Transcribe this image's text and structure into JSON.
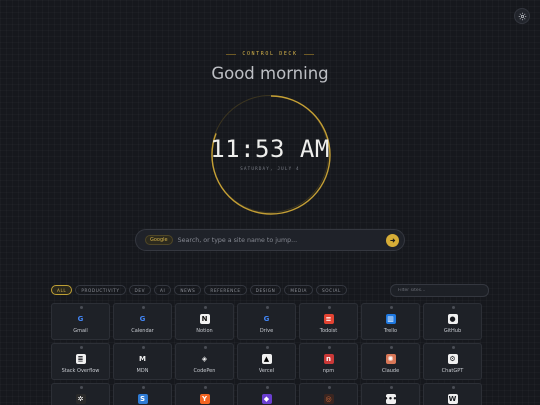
{
  "header": {
    "eyebrow": "CONTROL DECK",
    "greeting": "Good morning"
  },
  "clock": {
    "time": "11:53 AM",
    "date": "SATURDAY, JULY 4"
  },
  "search": {
    "engine": "Google",
    "placeholder": "Search, or type a site name to jump..."
  },
  "filters": {
    "chips": [
      "ALL",
      "PRODUCTIVITY",
      "DEV",
      "AI",
      "NEWS",
      "REFERENCE",
      "DESIGN",
      "MEDIA",
      "SOCIAL"
    ],
    "active": "ALL",
    "placeholder": "Filter sites..."
  },
  "colors": {
    "accent": "#d6ad37",
    "background": "#16181d",
    "tile": "#1e2127"
  },
  "sites": [
    {
      "label": "Gmail",
      "icon": "google-icon",
      "glyph": "G",
      "fg": "#4285f4",
      "bg": "transparent"
    },
    {
      "label": "Calendar",
      "icon": "google-icon",
      "glyph": "G",
      "fg": "#4285f4",
      "bg": "transparent"
    },
    {
      "label": "Notion",
      "icon": "notion-icon",
      "glyph": "N",
      "fg": "#111111",
      "bg": "#f2f2f2"
    },
    {
      "label": "Drive",
      "icon": "google-icon",
      "glyph": "G",
      "fg": "#4285f4",
      "bg": "transparent"
    },
    {
      "label": "Todoist",
      "icon": "todoist-icon",
      "glyph": "≡",
      "fg": "#ffffff",
      "bg": "#e44332"
    },
    {
      "label": "Trello",
      "icon": "trello-icon",
      "glyph": "▥",
      "fg": "#ffffff",
      "bg": "#1e78e0"
    },
    {
      "label": "GitHub",
      "icon": "github-icon",
      "glyph": "●",
      "fg": "#16181d",
      "bg": "#f0f0f0"
    },
    {
      "label": "Stack Overflow",
      "icon": "stackoverflow-icon",
      "glyph": "≣",
      "fg": "#16181d",
      "bg": "#f0f0f0"
    },
    {
      "label": "MDN",
      "icon": "mdn-icon",
      "glyph": "M",
      "fg": "#f0f0f0",
      "bg": "transparent"
    },
    {
      "label": "CodePen",
      "icon": "codepen-icon",
      "glyph": "◈",
      "fg": "#f0f0f0",
      "bg": "transparent"
    },
    {
      "label": "Vercel",
      "icon": "vercel-icon",
      "glyph": "▲",
      "fg": "#000000",
      "bg": "#f0f0f0"
    },
    {
      "label": "npm",
      "icon": "npm-icon",
      "glyph": "n",
      "fg": "#ffffff",
      "bg": "#cb3837"
    },
    {
      "label": "Claude",
      "icon": "claude-icon",
      "glyph": "✺",
      "fg": "#ffffff",
      "bg": "#d97757"
    },
    {
      "label": "ChatGPT",
      "icon": "chatgpt-icon",
      "glyph": "⚙",
      "fg": "#16181d",
      "bg": "#f0f0f0"
    },
    {
      "label": "",
      "icon": "app-icon",
      "glyph": "✲",
      "fg": "#ffffff",
      "bg": "#2a2a2a"
    },
    {
      "label": "",
      "icon": "app-icon",
      "glyph": "S",
      "fg": "#ffffff",
      "bg": "#2f7bd4"
    },
    {
      "label": "",
      "icon": "app-icon",
      "glyph": "Y",
      "fg": "#ffffff",
      "bg": "#f26522"
    },
    {
      "label": "",
      "icon": "app-icon",
      "glyph": "◆",
      "fg": "#ffffff",
      "bg": "#6b3fd1"
    },
    {
      "label": "",
      "icon": "app-icon",
      "glyph": "◎",
      "fg": "#d36b3b",
      "bg": "#3a2520"
    },
    {
      "label": "",
      "icon": "app-icon",
      "glyph": "•••",
      "fg": "#16181d",
      "bg": "#f0f0f0"
    },
    {
      "label": "",
      "icon": "app-icon",
      "glyph": "W",
      "fg": "#16181d",
      "bg": "#f0f0f0"
    }
  ]
}
